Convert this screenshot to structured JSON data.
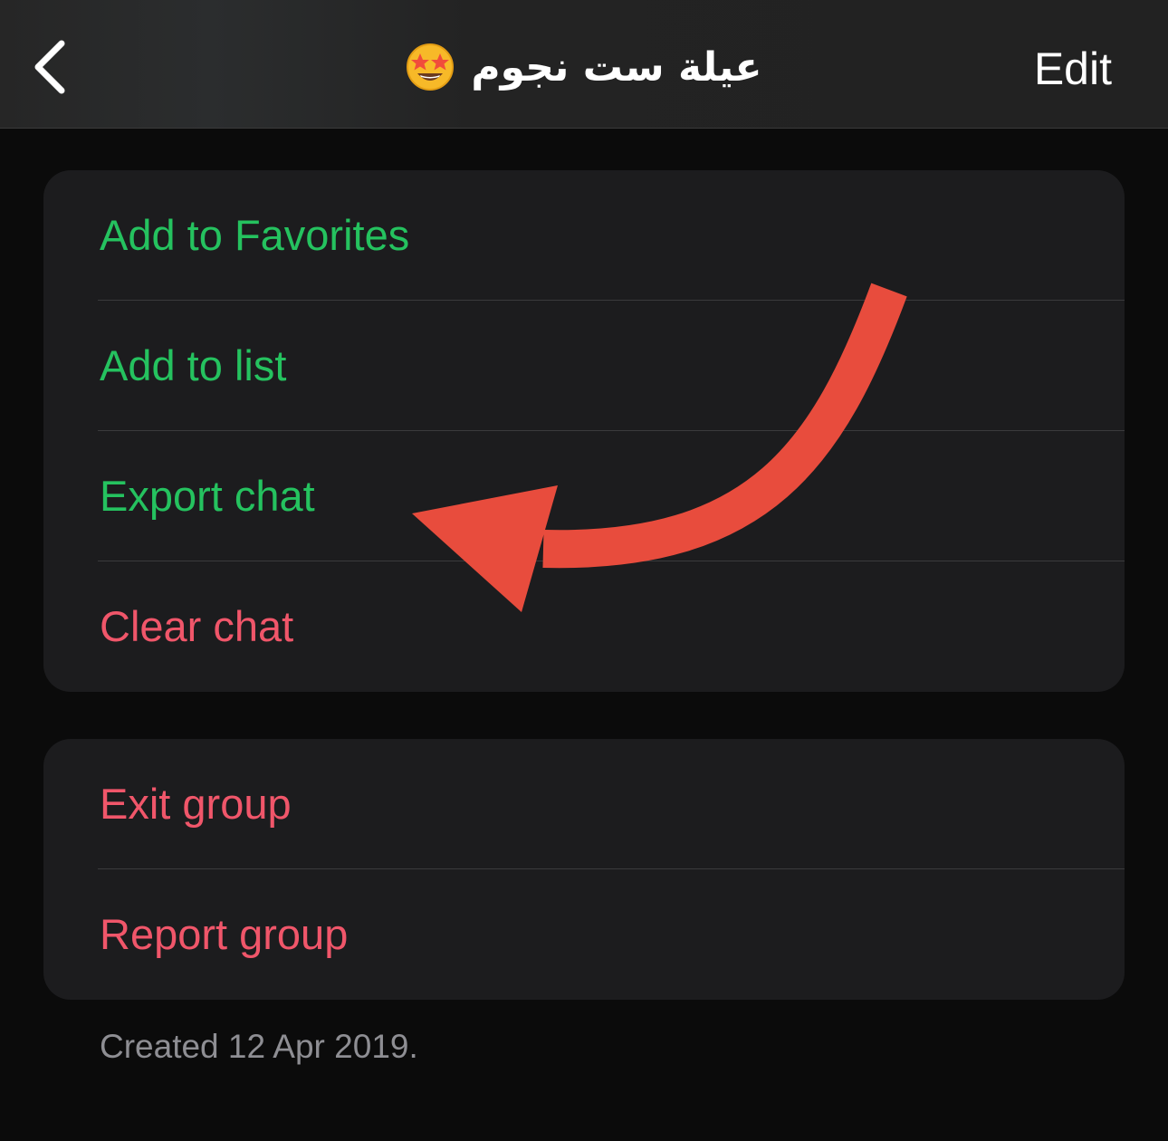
{
  "nav": {
    "back_icon": "chevron-left-icon",
    "title": "عيلة ست نجوم",
    "title_emoji_icon": "star-struck-emoji-icon",
    "edit_label": "Edit"
  },
  "actions_group": {
    "items": [
      {
        "label": "Add to Favorites",
        "color": "#25c25f"
      },
      {
        "label": "Add to list",
        "color": "#25c25f"
      },
      {
        "label": "Export chat",
        "color": "#25c25f"
      },
      {
        "label": "Clear chat",
        "color": "#f0566a"
      }
    ]
  },
  "danger_group": {
    "items": [
      {
        "label": "Exit group",
        "color": "#f0566a"
      },
      {
        "label": "Report group",
        "color": "#f0566a"
      }
    ]
  },
  "footer": {
    "created_text": "Created 12 Apr 2019."
  },
  "annotation": {
    "icon": "curved-arrow-icon",
    "color": "#e84c3d"
  },
  "colors": {
    "background": "#0b0b0b",
    "card": "#1c1c1e",
    "accent_green": "#25c25f",
    "destructive_red": "#f0566a",
    "secondary_text": "#8e8e93"
  }
}
